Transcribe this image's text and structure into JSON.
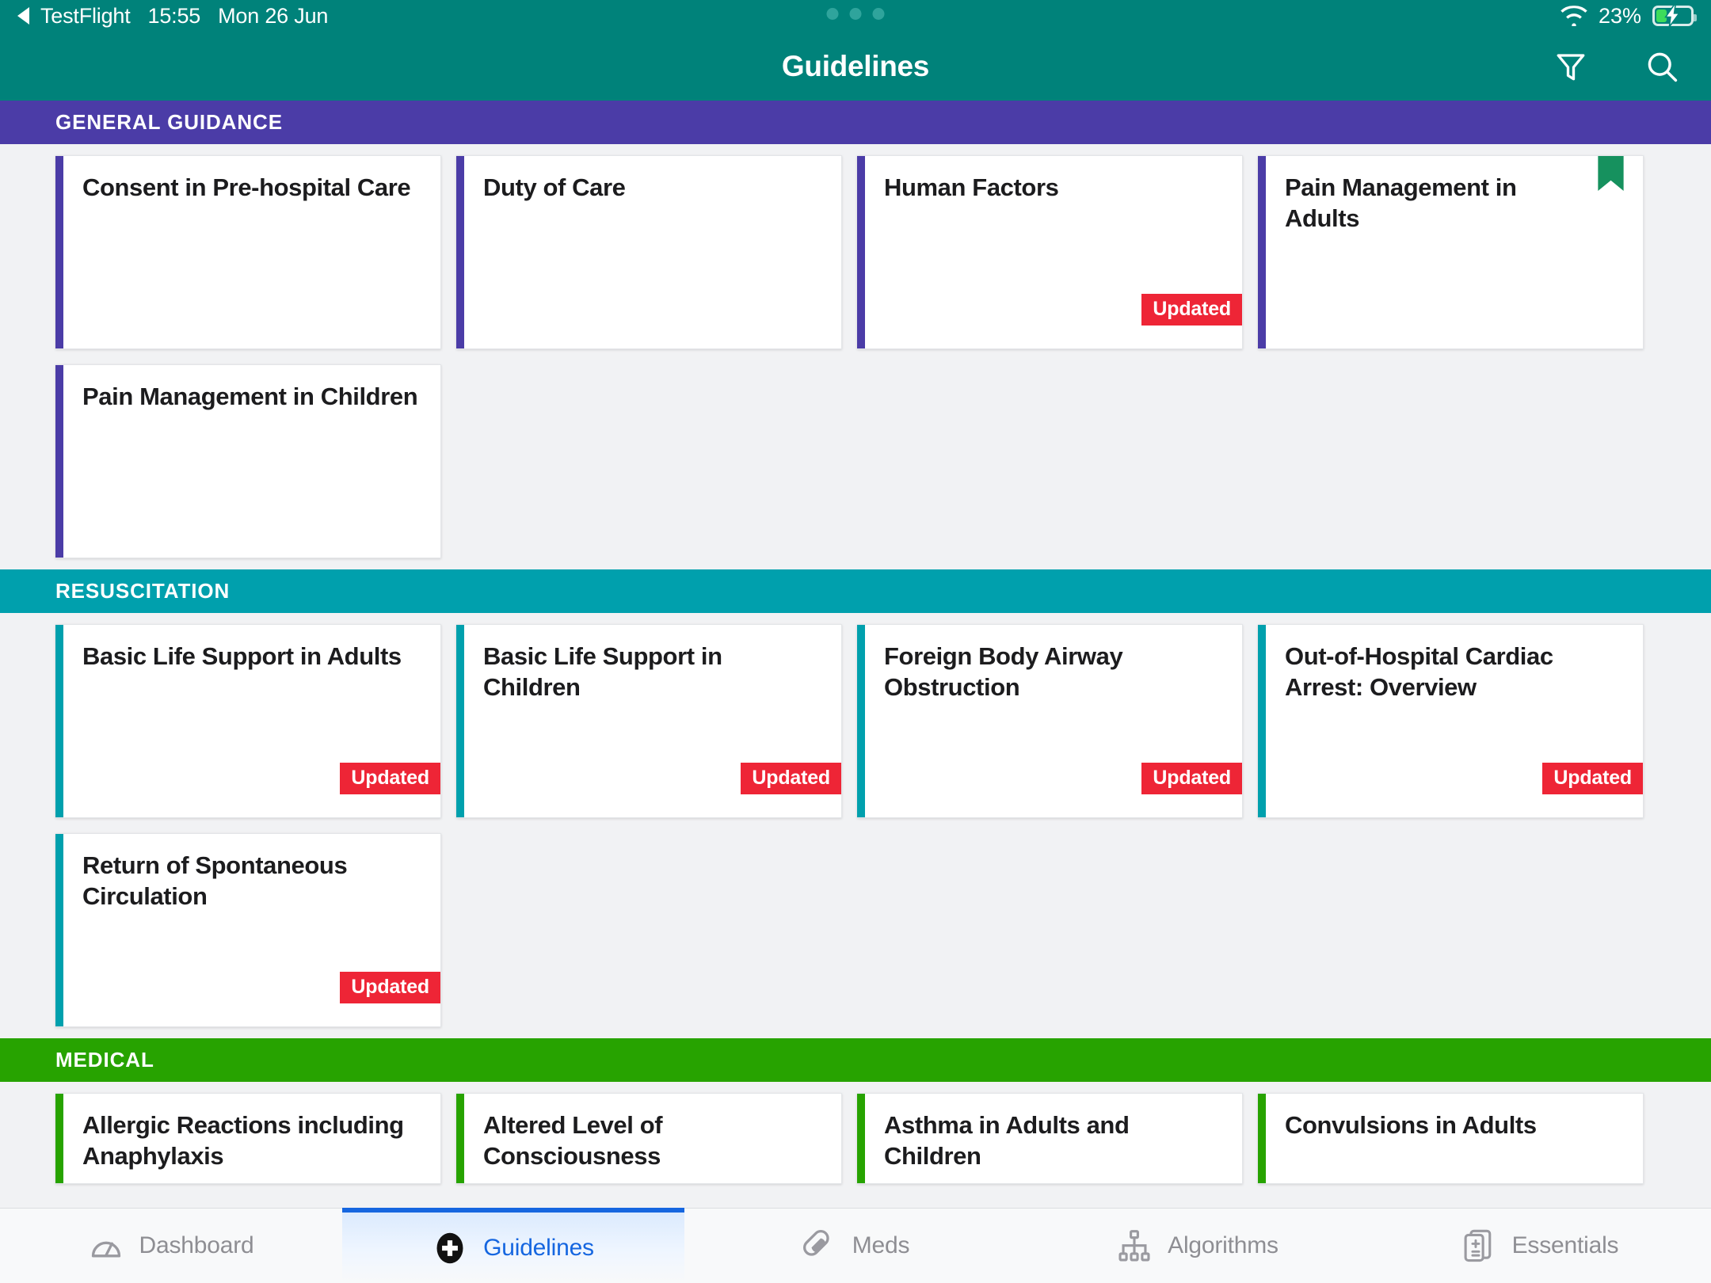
{
  "status_bar": {
    "back_app": "TestFlight",
    "time": "15:55",
    "date": "Mon 26 Jun",
    "battery_percent": "23%",
    "wifi_icon": "wifi-icon",
    "battery_icon": "battery-charging-icon",
    "back_icon": "back-chevron-icon"
  },
  "nav": {
    "title": "Guidelines",
    "filter_icon": "filter-icon",
    "search_icon": "search-icon"
  },
  "colors": {
    "header_teal": "#00827a",
    "general_purple": "#4b3ca7",
    "resus_teal": "#00a0ad",
    "medical_green": "#27a300",
    "badge_red": "#ee2536",
    "bookmark_green": "#16915e",
    "active_tab_blue": "#1566e0"
  },
  "sections": [
    {
      "title": "GENERAL GUIDANCE",
      "accent_class": "general",
      "cards": [
        {
          "title": "Consent in Pre-hospital Care",
          "updated": false,
          "bookmarked": false
        },
        {
          "title": "Duty of Care",
          "updated": false,
          "bookmarked": false
        },
        {
          "title": "Human Factors",
          "updated": true,
          "bookmarked": false
        },
        {
          "title": "Pain Management in Adults",
          "updated": false,
          "bookmarked": true
        },
        {
          "title": "Pain Management in Children",
          "updated": false,
          "bookmarked": false
        }
      ]
    },
    {
      "title": "RESUSCITATION",
      "accent_class": "resus",
      "cards": [
        {
          "title": "Basic Life Support in Adults",
          "updated": true,
          "bookmarked": false
        },
        {
          "title": "Basic Life Support in Children",
          "updated": true,
          "bookmarked": false
        },
        {
          "title": "Foreign Body Airway Obstruction",
          "updated": true,
          "bookmarked": false
        },
        {
          "title": "Out-of-Hospital Cardiac Arrest: Overview",
          "updated": true,
          "bookmarked": false
        },
        {
          "title": "Return of Spontaneous Circulation",
          "updated": true,
          "bookmarked": false
        }
      ]
    },
    {
      "title": "MEDICAL",
      "accent_class": "medical",
      "cards": [
        {
          "title": "Allergic Reactions including Anaphylaxis",
          "updated": false,
          "bookmarked": false
        },
        {
          "title": "Altered Level of Consciousness",
          "updated": false,
          "bookmarked": false
        },
        {
          "title": "Asthma in Adults and Children",
          "updated": false,
          "bookmarked": false
        },
        {
          "title": "Convulsions in Adults",
          "updated": false,
          "bookmarked": false
        }
      ]
    }
  ],
  "badge_label": "Updated",
  "tabs": [
    {
      "label": "Dashboard",
      "icon": "gauge-icon",
      "active": false
    },
    {
      "label": "Guidelines",
      "icon": "medical-cross-icon",
      "active": true
    },
    {
      "label": "Meds",
      "icon": "pill-icon",
      "active": false
    },
    {
      "label": "Algorithms",
      "icon": "flowchart-icon",
      "active": false
    },
    {
      "label": "Essentials",
      "icon": "cards-stack-icon",
      "active": false
    }
  ]
}
